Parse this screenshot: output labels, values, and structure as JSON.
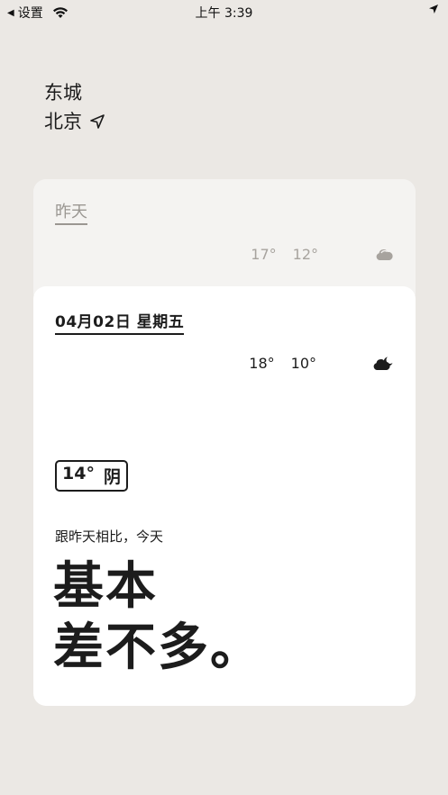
{
  "status_bar": {
    "back_label": "设置",
    "time": "上午 3:39"
  },
  "location": {
    "district": "东城",
    "city": "北京"
  },
  "yesterday": {
    "label": "昨天",
    "high": "17°",
    "low": "12°",
    "icon": "cloud-icon"
  },
  "today": {
    "date": "04月02日 星期五",
    "high": "18°",
    "low": "10°",
    "icon": "moon-cloud-icon",
    "current_temp": "14°",
    "current_condition": "阴",
    "compare_lead": "跟昨天相比，今天",
    "compare_line1": "基本",
    "compare_line2": "差不多。"
  }
}
